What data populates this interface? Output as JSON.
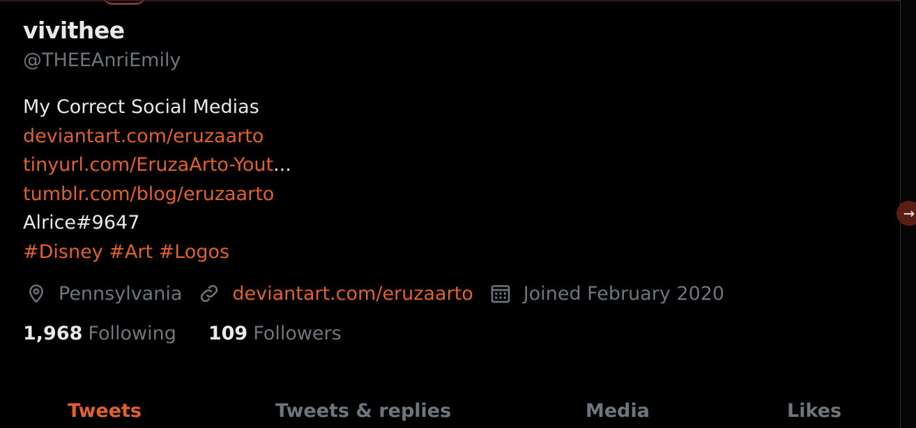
{
  "profile": {
    "display_name": "vivithee",
    "handle": "@THEEAnriEmily"
  },
  "bio": {
    "line1": "My Correct Social Medias",
    "link1": "deviantart.com/eruzaarto",
    "link2": "tinyurl.com/EruzaArto-Yout",
    "link2_ellipsis": "...",
    "link3": "tumblr.com/blog/eruzaarto",
    "discord": "Alrice#9647",
    "hashtags": [
      "#Disney",
      "#Art",
      "#Logos"
    ]
  },
  "meta": {
    "location": "Pennsylvania",
    "website": "deviantart.com/eruzaarto",
    "joined": "Joined February 2020",
    "icons": [
      "location-pin-icon",
      "link-icon",
      "calendar-icon"
    ]
  },
  "counts": {
    "following_num": "1,968",
    "following_label": "Following",
    "followers_num": "109",
    "followers_label": "Followers"
  },
  "tabs": {
    "tweets": "Tweets",
    "replies": "Tweets & replies",
    "media": "Media",
    "likes": "Likes",
    "active": "Tweets"
  },
  "colors": {
    "accent": "#e0612c",
    "text": "#e7e9ea",
    "muted": "#6e767d",
    "background": "#000000"
  },
  "nav": {
    "arrow_icon": "arrow-right-icon",
    "arrow_glyph": "→"
  }
}
